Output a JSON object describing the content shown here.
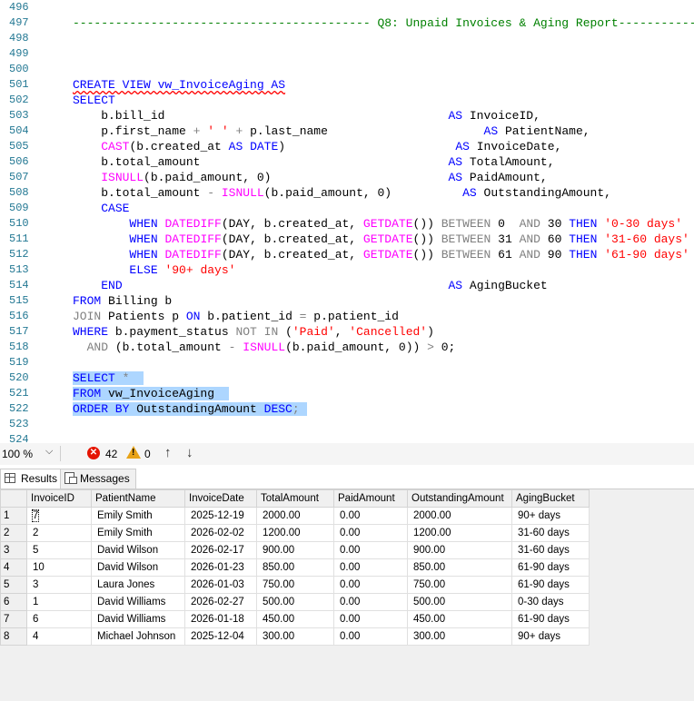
{
  "editor": {
    "lines": [
      {
        "n": "496",
        "tokens": []
      },
      {
        "n": "497",
        "tokens": [
          {
            "t": "------------------------------------------ Q8: Unpaid Invoices & Aging Report------------",
            "c": "cm"
          }
        ]
      },
      {
        "n": "498",
        "tokens": []
      },
      {
        "n": "499",
        "tokens": []
      },
      {
        "n": "500",
        "tokens": []
      },
      {
        "n": "501",
        "tokens": [
          {
            "t": "CREATE VIEW vw_InvoiceAging AS",
            "c": "kw sq"
          }
        ]
      },
      {
        "n": "502",
        "tokens": [
          {
            "t": "SELECT",
            "c": "kw"
          }
        ]
      },
      {
        "n": "503",
        "tokens": [
          {
            "t": "    b.bill_id                                        "
          },
          {
            "t": "AS",
            "c": "kw"
          },
          {
            "t": " InvoiceID,"
          }
        ]
      },
      {
        "n": "504",
        "tokens": [
          {
            "t": "    p.first_name "
          },
          {
            "t": "+",
            "c": "op"
          },
          {
            "t": " "
          },
          {
            "t": "' '",
            "c": "str"
          },
          {
            "t": " "
          },
          {
            "t": "+",
            "c": "op"
          },
          {
            "t": " p.last_name                      "
          },
          {
            "t": "AS",
            "c": "kw"
          },
          {
            "t": " PatientName,"
          }
        ]
      },
      {
        "n": "505",
        "tokens": [
          {
            "t": "    "
          },
          {
            "t": "CAST",
            "c": "fn"
          },
          {
            "t": "(b.created_at "
          },
          {
            "t": "AS",
            "c": "kw"
          },
          {
            "t": " "
          },
          {
            "t": "DATE",
            "c": "kw"
          },
          {
            "t": ")                        "
          },
          {
            "t": "AS",
            "c": "kw"
          },
          {
            "t": " InvoiceDate,"
          }
        ]
      },
      {
        "n": "506",
        "tokens": [
          {
            "t": "    b.total_amount                                   "
          },
          {
            "t": "AS",
            "c": "kw"
          },
          {
            "t": " TotalAmount,"
          }
        ]
      },
      {
        "n": "507",
        "tokens": [
          {
            "t": "    "
          },
          {
            "t": "ISNULL",
            "c": "fn"
          },
          {
            "t": "(b.paid_amount, 0)                         "
          },
          {
            "t": "AS",
            "c": "kw"
          },
          {
            "t": " PaidAmount,"
          }
        ]
      },
      {
        "n": "508",
        "tokens": [
          {
            "t": "    b.total_amount "
          },
          {
            "t": "-",
            "c": "op"
          },
          {
            "t": " "
          },
          {
            "t": "ISNULL",
            "c": "fn"
          },
          {
            "t": "(b.paid_amount, 0)          "
          },
          {
            "t": "AS",
            "c": "kw"
          },
          {
            "t": " OutstandingAmount,"
          }
        ]
      },
      {
        "n": "509",
        "tokens": [
          {
            "t": "    "
          },
          {
            "t": "CASE",
            "c": "kw"
          }
        ]
      },
      {
        "n": "510",
        "tokens": [
          {
            "t": "        "
          },
          {
            "t": "WHEN",
            "c": "kw"
          },
          {
            "t": " "
          },
          {
            "t": "DATEDIFF",
            "c": "fn"
          },
          {
            "t": "(DAY, b.created_at, "
          },
          {
            "t": "GETDATE",
            "c": "fn"
          },
          {
            "t": "()) "
          },
          {
            "t": "BETWEEN",
            "c": "op"
          },
          {
            "t": " 0  "
          },
          {
            "t": "AND",
            "c": "op"
          },
          {
            "t": " 30 "
          },
          {
            "t": "THEN",
            "c": "kw"
          },
          {
            "t": " "
          },
          {
            "t": "'0-30 days'",
            "c": "str"
          }
        ]
      },
      {
        "n": "511",
        "tokens": [
          {
            "t": "        "
          },
          {
            "t": "WHEN",
            "c": "kw"
          },
          {
            "t": " "
          },
          {
            "t": "DATEDIFF",
            "c": "fn"
          },
          {
            "t": "(DAY, b.created_at, "
          },
          {
            "t": "GETDATE",
            "c": "fn"
          },
          {
            "t": "()) "
          },
          {
            "t": "BETWEEN",
            "c": "op"
          },
          {
            "t": " 31 "
          },
          {
            "t": "AND",
            "c": "op"
          },
          {
            "t": " 60 "
          },
          {
            "t": "THEN",
            "c": "kw"
          },
          {
            "t": " "
          },
          {
            "t": "'31-60 days'",
            "c": "str"
          }
        ]
      },
      {
        "n": "512",
        "tokens": [
          {
            "t": "        "
          },
          {
            "t": "WHEN",
            "c": "kw"
          },
          {
            "t": " "
          },
          {
            "t": "DATEDIFF",
            "c": "fn"
          },
          {
            "t": "(DAY, b.created_at, "
          },
          {
            "t": "GETDATE",
            "c": "fn"
          },
          {
            "t": "()) "
          },
          {
            "t": "BETWEEN",
            "c": "op"
          },
          {
            "t": " 61 "
          },
          {
            "t": "AND",
            "c": "op"
          },
          {
            "t": " 90 "
          },
          {
            "t": "THEN",
            "c": "kw"
          },
          {
            "t": " "
          },
          {
            "t": "'61-90 days'",
            "c": "str"
          }
        ]
      },
      {
        "n": "513",
        "tokens": [
          {
            "t": "        "
          },
          {
            "t": "ELSE",
            "c": "kw"
          },
          {
            "t": " "
          },
          {
            "t": "'90+ days'",
            "c": "str"
          }
        ]
      },
      {
        "n": "514",
        "tokens": [
          {
            "t": "    "
          },
          {
            "t": "END",
            "c": "kw"
          },
          {
            "t": "                                              "
          },
          {
            "t": "AS",
            "c": "kw"
          },
          {
            "t": " AgingBucket"
          }
        ]
      },
      {
        "n": "515",
        "tokens": [
          {
            "t": "FROM",
            "c": "kw"
          },
          {
            "t": " Billing b"
          }
        ]
      },
      {
        "n": "516",
        "tokens": [
          {
            "t": "JOIN",
            "c": "op"
          },
          {
            "t": " Patients p "
          },
          {
            "t": "ON",
            "c": "kw"
          },
          {
            "t": " b.patient_id "
          },
          {
            "t": "=",
            "c": "op"
          },
          {
            "t": " p.patient_id"
          }
        ]
      },
      {
        "n": "517",
        "tokens": [
          {
            "t": "WHERE",
            "c": "kw"
          },
          {
            "t": " b.payment_status "
          },
          {
            "t": "NOT IN",
            "c": "op"
          },
          {
            "t": " ("
          },
          {
            "t": "'Paid'",
            "c": "str"
          },
          {
            "t": ", "
          },
          {
            "t": "'Cancelled'",
            "c": "str"
          },
          {
            "t": ")"
          }
        ]
      },
      {
        "n": "518",
        "tokens": [
          {
            "t": "  "
          },
          {
            "t": "AND",
            "c": "op"
          },
          {
            "t": " (b.total_amount "
          },
          {
            "t": "-",
            "c": "op"
          },
          {
            "t": " "
          },
          {
            "t": "ISNULL",
            "c": "fn"
          },
          {
            "t": "(b.paid_amount, 0)) "
          },
          {
            "t": ">",
            "c": "op"
          },
          {
            "t": " 0;"
          }
        ]
      },
      {
        "n": "519",
        "tokens": []
      },
      {
        "n": "520",
        "tokens": [
          {
            "t": "SELECT",
            "c": "kw sel"
          },
          {
            "t": " ",
            "c": "sel"
          },
          {
            "t": "*",
            "c": "op sel"
          },
          {
            "t": "  ",
            "c": "sel"
          }
        ]
      },
      {
        "n": "521",
        "tokens": [
          {
            "t": "FROM",
            "c": "kw sel"
          },
          {
            "t": " vw_InvoiceAging  ",
            "c": "sel"
          }
        ]
      },
      {
        "n": "522",
        "tokens": [
          {
            "t": "ORDER BY",
            "c": "kw sel"
          },
          {
            "t": " OutstandingAmount ",
            "c": "sel"
          },
          {
            "t": "DESC",
            "c": "kw sel"
          },
          {
            "t": ";",
            "c": "op sel"
          },
          {
            "t": " ",
            "c": "sel"
          }
        ]
      },
      {
        "n": "523",
        "tokens": []
      },
      {
        "n": "524",
        "tokens": []
      }
    ]
  },
  "status": {
    "zoom": "100 %",
    "zoom_arrow": "⌵",
    "error_icon": "✕",
    "error_count": "42",
    "warning_mark": "!",
    "warning_count": "0",
    "nav_up": "↑",
    "nav_down": "↓"
  },
  "tabs": {
    "results": "Results",
    "messages": "Messages"
  },
  "results": {
    "columns": [
      "",
      "InvoiceID",
      "PatientName",
      "InvoiceDate",
      "TotalAmount",
      "PaidAmount",
      "OutstandingAmount",
      "AgingBucket"
    ],
    "rows": [
      [
        "1",
        "7",
        "Emily Smith",
        "2025-12-19",
        "2000.00",
        "0.00",
        "2000.00",
        "90+ days"
      ],
      [
        "2",
        "2",
        "Emily Smith",
        "2026-02-02",
        "1200.00",
        "0.00",
        "1200.00",
        "31-60 days"
      ],
      [
        "3",
        "5",
        "David Wilson",
        "2026-02-17",
        "900.00",
        "0.00",
        "900.00",
        "31-60 days"
      ],
      [
        "4",
        "10",
        "David Wilson",
        "2026-01-23",
        "850.00",
        "0.00",
        "850.00",
        "61-90 days"
      ],
      [
        "5",
        "3",
        "Laura Jones",
        "2026-01-03",
        "750.00",
        "0.00",
        "750.00",
        "61-90 days"
      ],
      [
        "6",
        "1",
        "David Williams",
        "2026-02-27",
        "500.00",
        "0.00",
        "500.00",
        "0-30 days"
      ],
      [
        "7",
        "6",
        "David Williams",
        "2026-01-18",
        "450.00",
        "0.00",
        "450.00",
        "61-90 days"
      ],
      [
        "8",
        "4",
        "Michael Johnson",
        "2025-12-04",
        "300.00",
        "0.00",
        "300.00",
        "90+ days"
      ]
    ]
  }
}
